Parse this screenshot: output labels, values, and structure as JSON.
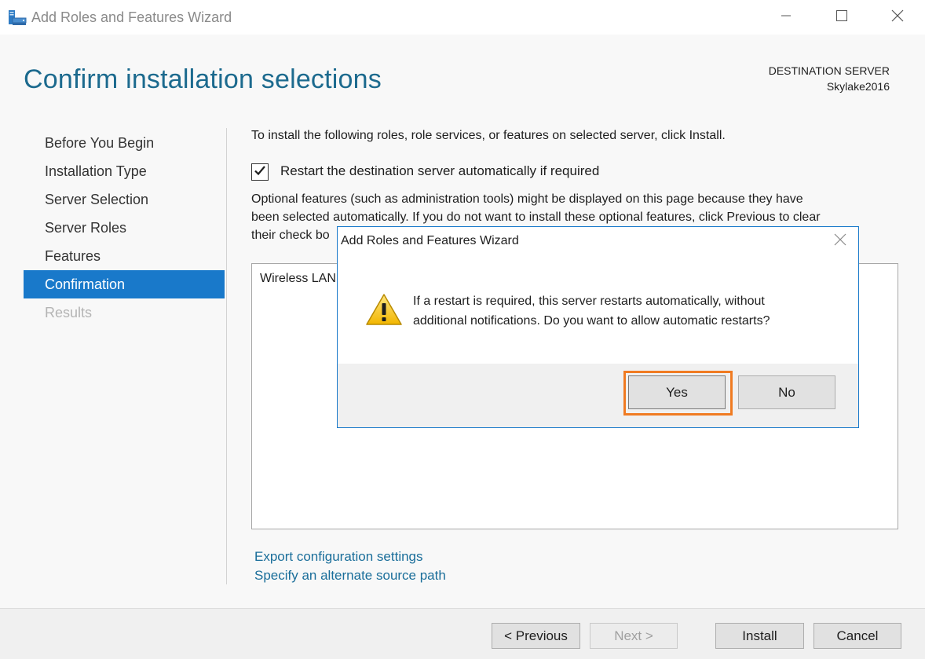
{
  "window": {
    "title": "Add Roles and Features Wizard",
    "minimize_icon": "minimize-icon",
    "maximize_icon": "maximize-icon",
    "close_icon": "close-icon"
  },
  "header": {
    "title": "Confirm installation selections",
    "destination_label": "DESTINATION SERVER",
    "destination_server": "Skylake2016"
  },
  "nav": {
    "items": [
      {
        "label": "Before You Begin",
        "state": "normal"
      },
      {
        "label": "Installation Type",
        "state": "normal"
      },
      {
        "label": "Server Selection",
        "state": "normal"
      },
      {
        "label": "Server Roles",
        "state": "normal"
      },
      {
        "label": "Features",
        "state": "normal"
      },
      {
        "label": "Confirmation",
        "state": "active"
      },
      {
        "label": "Results",
        "state": "disabled"
      }
    ]
  },
  "main": {
    "intro": "To install the following roles, role services, or features on selected server, click Install.",
    "restart_checkbox": {
      "label": "Restart the destination server automatically if required",
      "checked": true
    },
    "optional_text_line1": "Optional features (such as administration tools) might be displayed on this page because they have",
    "optional_text_line2": "been selected automatically. If you do not want to install these optional features, click Previous to clear",
    "optional_text_line3": "their check bo",
    "feature_list_item": "Wireless LAN",
    "links": {
      "export": "Export configuration settings",
      "source": "Specify an alternate source path"
    }
  },
  "footer": {
    "previous": "< Previous",
    "next": "Next >",
    "install": "Install",
    "cancel": "Cancel"
  },
  "dialog": {
    "title": "Add Roles and Features Wizard",
    "icon": "warning-icon",
    "message_line1": "If a restart is required, this server restarts automatically, without",
    "message_line2": "additional notifications. Do you want to allow automatic restarts?",
    "yes": "Yes",
    "no": "No"
  },
  "colors": {
    "accent": "#1979ca",
    "title_teal": "#1c6a8e",
    "link": "#1a6e9a",
    "highlight": "#f07b22"
  }
}
